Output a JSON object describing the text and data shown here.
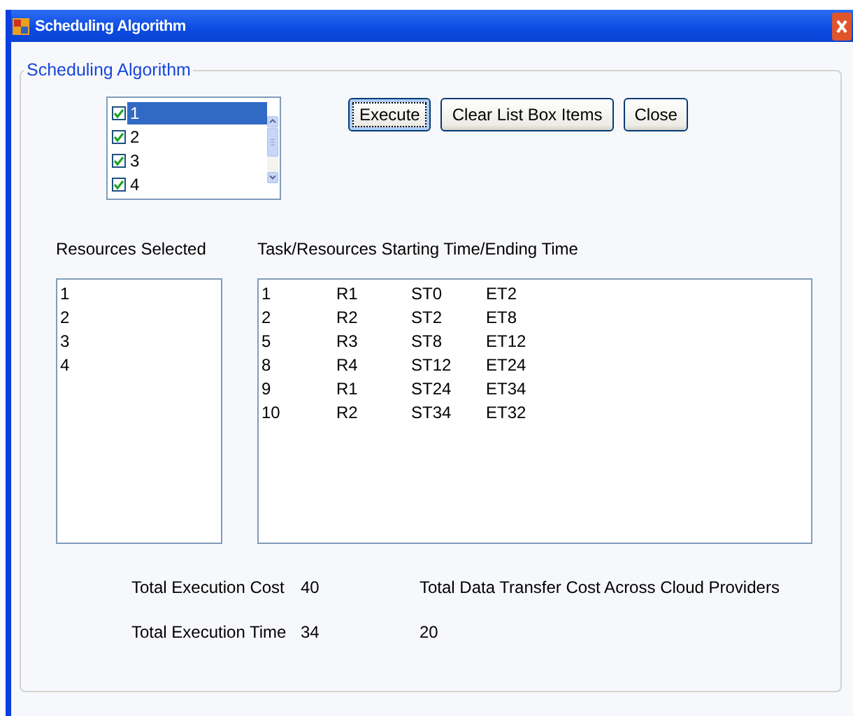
{
  "window": {
    "title": "Scheduling Algorithm"
  },
  "group": {
    "title": "Scheduling Algorithm"
  },
  "checklist": {
    "items": [
      {
        "label": "1",
        "checked": true,
        "selected": true
      },
      {
        "label": "2",
        "checked": true,
        "selected": false
      },
      {
        "label": "3",
        "checked": true,
        "selected": false
      },
      {
        "label": "4",
        "checked": true,
        "selected": false
      }
    ]
  },
  "buttons": [
    {
      "label": "Execute",
      "focused": true
    },
    {
      "label": "Clear List Box Items",
      "focused": false
    },
    {
      "label": "Close",
      "focused": false
    }
  ],
  "resources": {
    "heading": "Resources Selected",
    "items": [
      "1",
      "2",
      "3",
      "4"
    ]
  },
  "schedule": {
    "heading": "Task/Resources Starting Time/Ending Time",
    "rows": [
      [
        "1",
        "R1",
        "ST0",
        "ET2"
      ],
      [
        "2",
        "R2",
        "ST2",
        "ET8"
      ],
      [
        "5",
        "R3",
        "ST8",
        "ET12"
      ],
      [
        "8",
        "R4",
        "ST12",
        "ET24"
      ],
      [
        "9",
        "R1",
        "ST24",
        "ET34"
      ],
      [
        "10",
        "R2",
        "ST34",
        "ET32"
      ]
    ]
  },
  "totals": {
    "cost_label": "Total Execution Cost",
    "cost": "40",
    "time_label": "Total Execution Time",
    "time": "34",
    "transfer_label": "Total Data Transfer Cost Across Cloud Providers",
    "transfer": "20"
  }
}
